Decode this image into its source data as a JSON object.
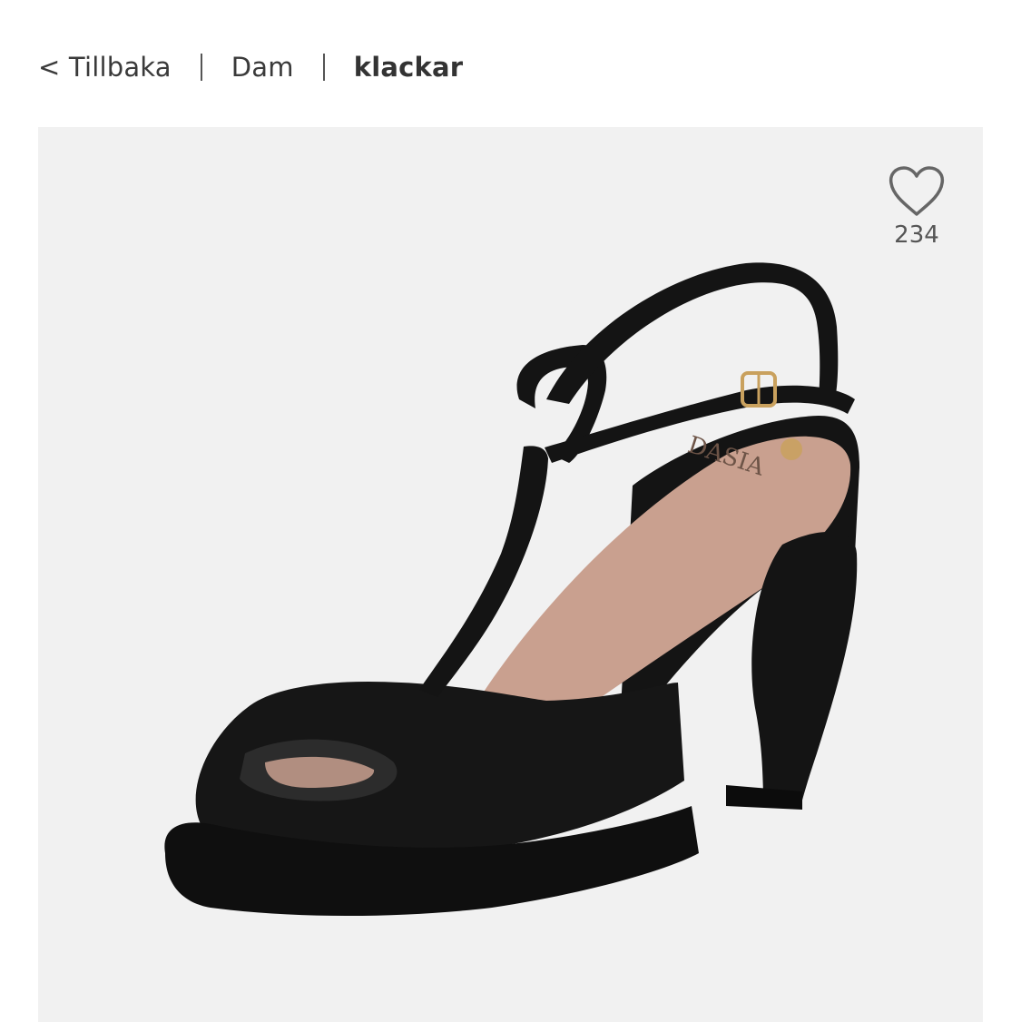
{
  "breadcrumb": {
    "back_label": "< Tillbaka",
    "items": [
      "Dam",
      "klackar"
    ]
  },
  "product": {
    "image_icon": "shoe-image",
    "brand_on_insole": "DASIA",
    "favorite": {
      "icon": "heart-outline-icon",
      "count": "234"
    }
  },
  "colors": {
    "gallery_bg": "#f1f1f1",
    "shoe": "#141414",
    "insole": "#c9a08f",
    "buckle": "#c9a15e"
  }
}
